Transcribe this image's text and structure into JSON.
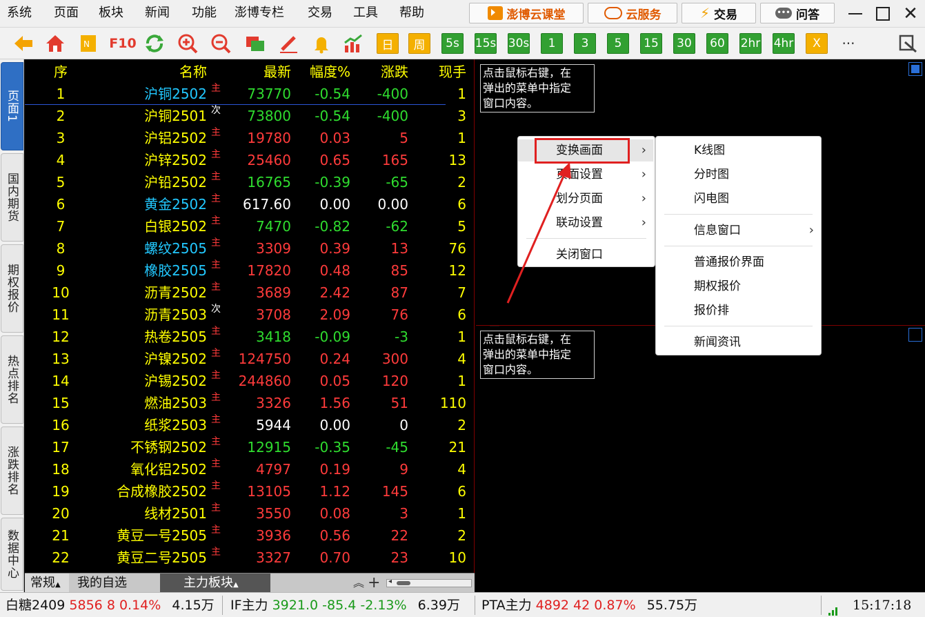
{
  "menu": [
    "系统",
    "页面",
    "板块",
    "新闻",
    "功能",
    "澎博专栏",
    "交易",
    "工具",
    "帮助"
  ],
  "ext_buttons": {
    "classroom": "澎博云课堂",
    "cloud": "云服务",
    "trade": "交易",
    "qa": "问答"
  },
  "toolbar": {
    "icons": [
      "back-arrow-icon",
      "home-icon",
      "notes-icon",
      "f10-icon",
      "refresh-icon",
      "zoom-in-icon",
      "zoom-out-icon",
      "window-icon",
      "pen-icon",
      "bell-icon",
      "chart-up-icon"
    ],
    "f10_label": "F10",
    "periods": [
      "日",
      "周",
      "5s",
      "15s",
      "30s",
      "1",
      "3",
      "5",
      "15",
      "30",
      "60",
      "2hr",
      "4hr",
      "X"
    ],
    "more": "···"
  },
  "left_tabs": [
    "页面1",
    "国内期货",
    "期权报价",
    "热点排名",
    "涨跌排名",
    "数据中心"
  ],
  "quote": {
    "headers": {
      "seq": "序",
      "name": "名称",
      "price": "最新",
      "pct": "幅度%",
      "chg": "涨跌",
      "vol": "现手"
    },
    "rows": [
      {
        "seq": "1",
        "name": "沪铜2502",
        "mark": "主",
        "price": "73770",
        "pct": "-0.54",
        "chg": "-400",
        "vol": "1",
        "dir": "dn",
        "ncolor": "#22c8ff"
      },
      {
        "seq": "2",
        "name": "沪铜2501",
        "mark": "次",
        "price": "73800",
        "pct": "-0.54",
        "chg": "-400",
        "vol": "3",
        "dir": "dn",
        "ncolor": "#ffff00"
      },
      {
        "seq": "3",
        "name": "沪铝2502",
        "mark": "主",
        "price": "19780",
        "pct": "0.03",
        "chg": "5",
        "vol": "1",
        "dir": "up",
        "ncolor": "#ffff00"
      },
      {
        "seq": "4",
        "name": "沪锌2502",
        "mark": "主",
        "price": "25460",
        "pct": "0.65",
        "chg": "165",
        "vol": "13",
        "dir": "up",
        "ncolor": "#ffff00"
      },
      {
        "seq": "5",
        "name": "沪铅2502",
        "mark": "主",
        "price": "16765",
        "pct": "-0.39",
        "chg": "-65",
        "vol": "2",
        "dir": "dn",
        "ncolor": "#ffff00"
      },
      {
        "seq": "6",
        "name": "黄金2502",
        "mark": "主",
        "price": "617.60",
        "pct": "0.00",
        "chg": "0.00",
        "vol": "6",
        "dir": "fl",
        "ncolor": "#22c8ff"
      },
      {
        "seq": "7",
        "name": "白银2502",
        "mark": "主",
        "price": "7470",
        "pct": "-0.82",
        "chg": "-62",
        "vol": "5",
        "dir": "dn",
        "ncolor": "#ffff00"
      },
      {
        "seq": "8",
        "name": "螺纹2505",
        "mark": "主",
        "price": "3309",
        "pct": "0.39",
        "chg": "13",
        "vol": "76",
        "dir": "up",
        "ncolor": "#22c8ff"
      },
      {
        "seq": "9",
        "name": "橡胶2505",
        "mark": "主",
        "price": "17820",
        "pct": "0.48",
        "chg": "85",
        "vol": "12",
        "dir": "up",
        "ncolor": "#22c8ff"
      },
      {
        "seq": "10",
        "name": "沥青2502",
        "mark": "主",
        "price": "3689",
        "pct": "2.42",
        "chg": "87",
        "vol": "7",
        "dir": "up",
        "ncolor": "#ffff00"
      },
      {
        "seq": "11",
        "name": "沥青2503",
        "mark": "次",
        "price": "3708",
        "pct": "2.09",
        "chg": "76",
        "vol": "6",
        "dir": "up",
        "ncolor": "#ffff00"
      },
      {
        "seq": "12",
        "name": "热卷2505",
        "mark": "主",
        "price": "3418",
        "pct": "-0.09",
        "chg": "-3",
        "vol": "1",
        "dir": "dn",
        "ncolor": "#ffff00"
      },
      {
        "seq": "13",
        "name": "沪镍2502",
        "mark": "主",
        "price": "124750",
        "pct": "0.24",
        "chg": "300",
        "vol": "4",
        "dir": "up",
        "ncolor": "#ffff00"
      },
      {
        "seq": "14",
        "name": "沪锡2502",
        "mark": "主",
        "price": "244860",
        "pct": "0.05",
        "chg": "120",
        "vol": "1",
        "dir": "up",
        "ncolor": "#ffff00"
      },
      {
        "seq": "15",
        "name": "燃油2503",
        "mark": "主",
        "price": "3326",
        "pct": "1.56",
        "chg": "51",
        "vol": "110",
        "dir": "up",
        "ncolor": "#ffff00"
      },
      {
        "seq": "16",
        "name": "纸浆2503",
        "mark": "主",
        "price": "5944",
        "pct": "0.00",
        "chg": "0",
        "vol": "2",
        "dir": "fl",
        "ncolor": "#ffff00"
      },
      {
        "seq": "17",
        "name": "不锈钢2502",
        "mark": "主",
        "price": "12915",
        "pct": "-0.35",
        "chg": "-45",
        "vol": "21",
        "dir": "dn",
        "ncolor": "#ffff00"
      },
      {
        "seq": "18",
        "name": "氧化铝2502",
        "mark": "主",
        "price": "4797",
        "pct": "0.19",
        "chg": "9",
        "vol": "4",
        "dir": "up",
        "ncolor": "#ffff00"
      },
      {
        "seq": "19",
        "name": "合成橡胶2502",
        "mark": "主",
        "price": "13105",
        "pct": "1.12",
        "chg": "145",
        "vol": "6",
        "dir": "up",
        "ncolor": "#ffff00"
      },
      {
        "seq": "20",
        "name": "线材2501",
        "mark": "主",
        "price": "3550",
        "pct": "0.08",
        "chg": "3",
        "vol": "1",
        "dir": "up",
        "ncolor": "#ffff00"
      },
      {
        "seq": "21",
        "name": "黄豆一号2505",
        "mark": "主",
        "price": "3936",
        "pct": "0.56",
        "chg": "22",
        "vol": "2",
        "dir": "up",
        "ncolor": "#ffff00"
      },
      {
        "seq": "22",
        "name": "黄豆二号2505",
        "mark": "主",
        "price": "3327",
        "pct": "0.70",
        "chg": "23",
        "vol": "10",
        "dir": "up",
        "ncolor": "#ffff00"
      }
    ]
  },
  "quote_tabs": {
    "normal": "常规",
    "fav": "我的自选",
    "main": "主力板块"
  },
  "hint_text": [
    "点击鼠标右键，在",
    "弹出的菜单中指定",
    "窗口内容。"
  ],
  "context_menu": [
    "变换画面",
    "页面设置",
    "划分页面",
    "联动设置",
    "关闭窗口"
  ],
  "submenu": [
    "K线图",
    "分时图",
    "闪电图",
    "信息窗口",
    "普通报价界面",
    "期权报价",
    "报价排",
    "新闻资讯"
  ],
  "statusbar": [
    {
      "name": "白糖2409",
      "price": "5856",
      "chg": "8",
      "pct": "0.14%",
      "vol": "4.15万",
      "dir": "up"
    },
    {
      "name": "IF主力",
      "price": "3921.0",
      "chg": "-85.4",
      "pct": "-2.13%",
      "vol": "6.39万",
      "dir": "dn"
    },
    {
      "name": "PTA主力",
      "price": "4892",
      "chg": "42",
      "pct": "0.87%",
      "vol": "55.75万",
      "dir": "up"
    }
  ],
  "clock": "15:17:18",
  "colors": {
    "up": "#ff3b3b",
    "down": "#2fdc2f",
    "flat": "#ffffff",
    "highlight": "#e02020",
    "accent": "#2f6fc4"
  }
}
